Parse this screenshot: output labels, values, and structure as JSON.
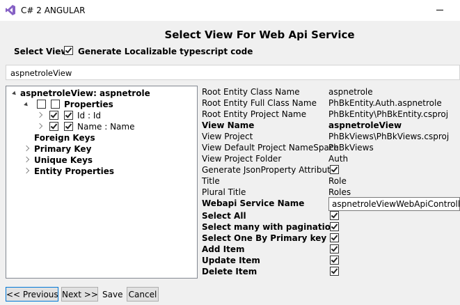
{
  "window": {
    "title": "C# 2 ANGULAR",
    "logo_icon": "visual-studio-icon"
  },
  "header": {
    "title": "Select View For Web Api Service",
    "select_view_label": "Select View.",
    "generate_localizable_label": "Generate Localizable typescript code",
    "generate_localizable_checked": true
  },
  "view_bar": {
    "text": "aspnetroleView"
  },
  "tree": {
    "root_label": "aspnetroleView: aspnetrole",
    "properties_label": "Properties",
    "property_items": [
      {
        "label": "Id : Id",
        "checked": true
      },
      {
        "label": "Name : Name",
        "checked": true
      }
    ],
    "foreign_keys_label": "Foreign Keys",
    "primary_key_label": "Primary Key",
    "unique_keys_label": "Unique Keys",
    "entity_properties_label": "Entity Properties"
  },
  "details": {
    "root_entity_class_name_label": "Root Entity Class Name",
    "root_entity_class_name_value": "aspnetrole",
    "root_entity_full_class_name_label": "Root Entity Full Class Name",
    "root_entity_full_class_name_value": "PhBkEntity.Auth.aspnetrole",
    "root_entity_project_name_label": "Root Entity Project Name",
    "root_entity_project_name_value": "PhBkEntity\\PhBkEntity.csproj",
    "view_name_label": "View Name",
    "view_name_value": "aspnetroleView",
    "view_project_label": "View Project",
    "view_project_value": "PhBkViews\\PhBkViews.csproj",
    "view_default_namespace_label": "View Default Project NameSpace",
    "view_default_namespace_value": "PhBkViews",
    "view_project_folder_label": "View Project Folder",
    "view_project_folder_value": "Auth",
    "generate_json_property_label": "Generate JsonProperty Attribute",
    "generate_json_property_checked": true,
    "title_label": "Title",
    "title_value": "Role",
    "plural_title_label": "Plural Title",
    "plural_title_value": "Roles",
    "webapi_service_name_label": "Webapi Service Name",
    "webapi_service_name_value": "aspnetroleViewWebApiController",
    "select_all_label": "Select All",
    "select_all_checked": true,
    "select_many_label": "Select many with pagination",
    "select_many_checked": true,
    "select_one_label": "Select One By Primary key",
    "select_one_checked": true,
    "add_item_label": "Add Item",
    "add_item_checked": true,
    "update_item_label": "Update Item",
    "update_item_checked": true,
    "delete_item_label": "Delete Item",
    "delete_item_checked": true
  },
  "footer": {
    "previous_label": "<< Previous",
    "next_label": "Next >>",
    "save_label": "Save",
    "cancel_label": "Cancel"
  }
}
